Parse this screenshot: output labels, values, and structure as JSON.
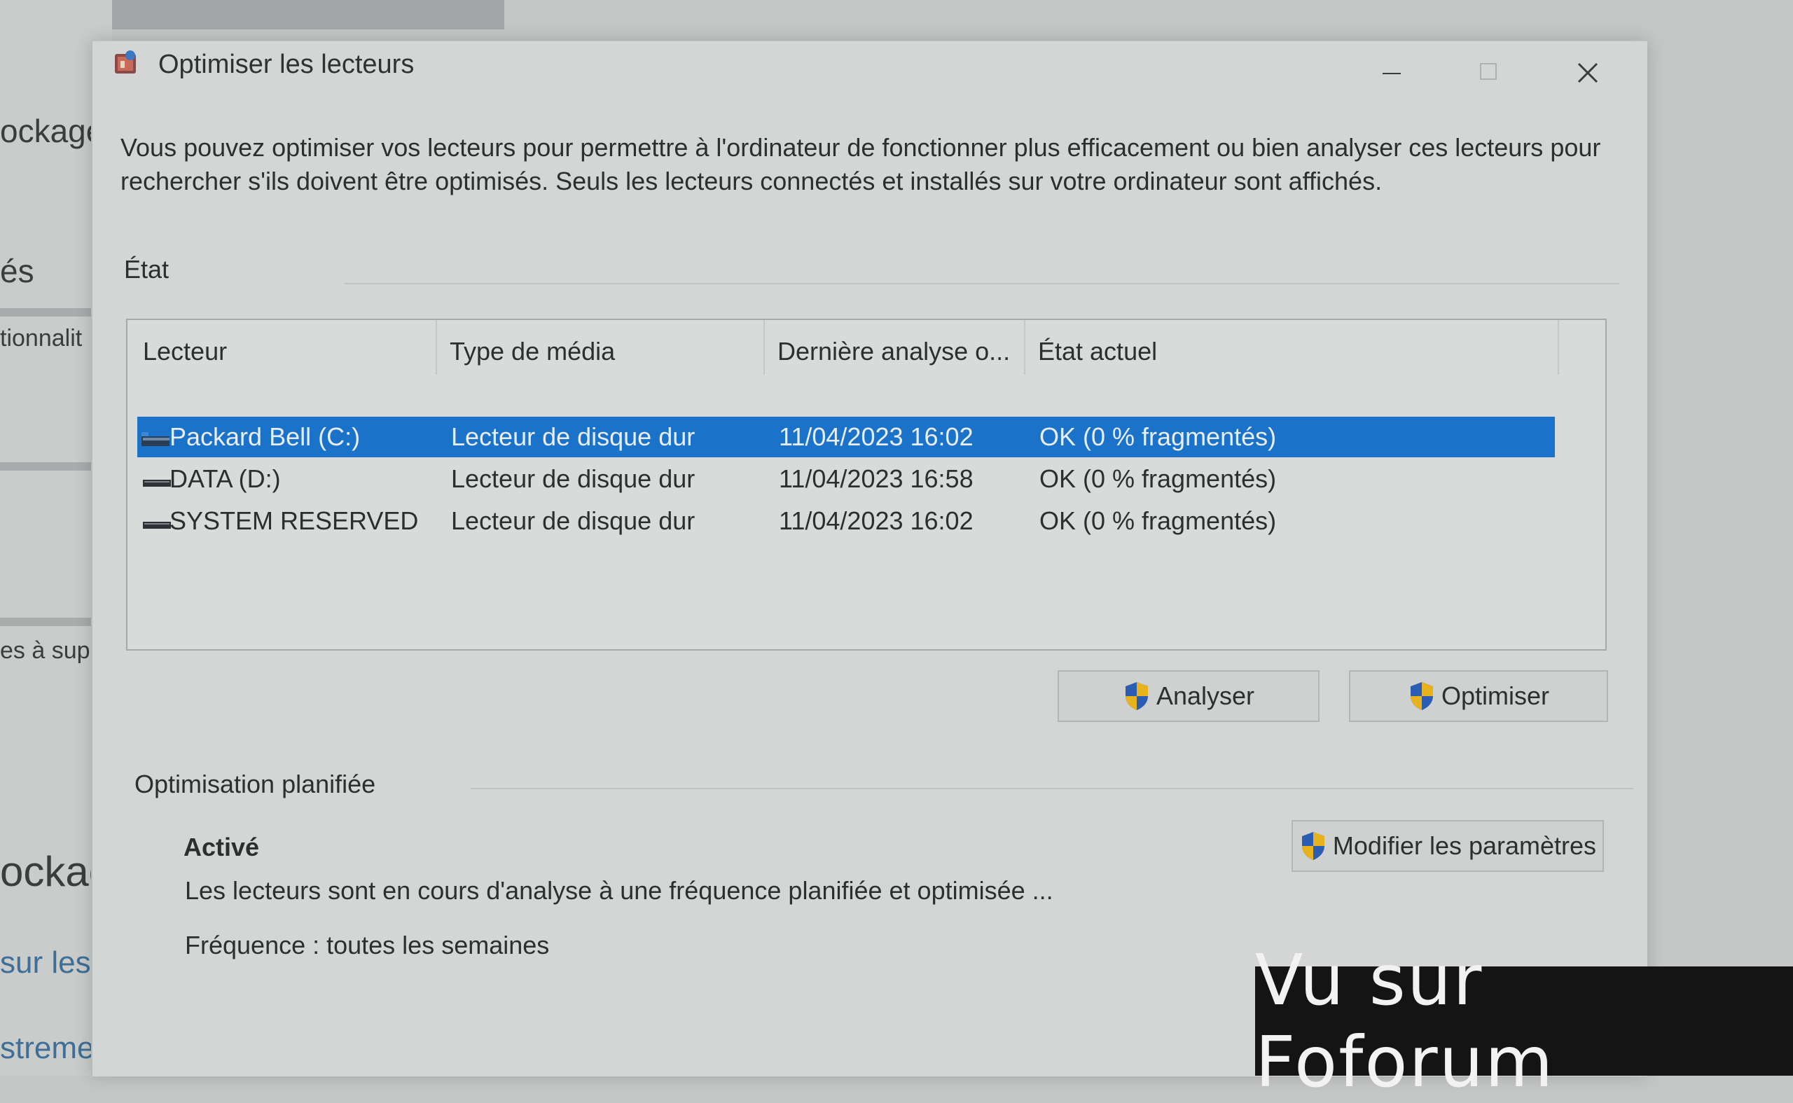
{
  "background_app": {
    "fragments": [
      "ockage",
      "és",
      "tionnalit",
      "es à supp",
      "ockage",
      "sur les a",
      "stremer"
    ]
  },
  "dialog": {
    "title": "Optimiser les lecteurs",
    "description": "Vous pouvez optimiser vos lecteurs pour permettre à l'ordinateur de fonctionner plus efficacement ou bien analyser ces lecteurs pour rechercher s'ils doivent être optimisés. Seuls les lecteurs connectés et installés sur votre ordinateur sont affichés.",
    "status_section_label": "État",
    "table": {
      "columns": [
        "Lecteur",
        "Type de média",
        "Dernière analyse o...",
        "État actuel"
      ],
      "rows": [
        {
          "drive": "Packard Bell (C:)",
          "media": "Lecteur de disque dur",
          "last": "11/04/2023 16:02",
          "state": "OK (0 % fragmentés)",
          "selected": true
        },
        {
          "drive": "DATA (D:)",
          "media": "Lecteur de disque dur",
          "last": "11/04/2023 16:58",
          "state": "OK (0 % fragmentés)",
          "selected": false
        },
        {
          "drive": "SYSTEM RESERVED",
          "media": "Lecteur de disque dur",
          "last": "11/04/2023 16:02",
          "state": "OK (0 % fragmentés)",
          "selected": false
        }
      ]
    },
    "buttons": {
      "analyze": "Analyser",
      "optimize": "Optimiser",
      "modify": "Modifier les paramètres"
    },
    "scheduled": {
      "label": "Optimisation planifiée",
      "status": "Activé",
      "description": "Les lecteurs sont en cours d'analyse à une fréquence planifiée et optimisée ...",
      "frequency": "Fréquence : toutes les semaines"
    }
  },
  "watermark": "Vu sur Foforum",
  "colors": {
    "selection": "#1a73c9",
    "shield_blue": "#2b5db3",
    "shield_gold": "#e8b21e"
  }
}
